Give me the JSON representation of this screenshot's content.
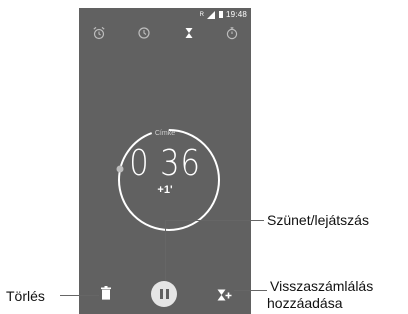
{
  "status_bar": {
    "time": "19:48",
    "signal_marker": "R"
  },
  "tabs": [
    {
      "name": "alarm-icon",
      "active": false
    },
    {
      "name": "clock-icon",
      "active": false
    },
    {
      "name": "hourglass-icon",
      "active": true
    },
    {
      "name": "stopwatch-icon",
      "active": false
    }
  ],
  "timer": {
    "label": "Címke",
    "time": "0 36",
    "plus_one": "+1'"
  },
  "controls": {
    "delete_icon": "trash-icon",
    "pause_icon": "pause-icon",
    "add_timer_icon": "hourglass-plus-icon"
  },
  "annotations": {
    "pause_play": "Szünet/lejátszás",
    "delete": "Törlés",
    "add_timer_line1": "Visszaszámlálás",
    "add_timer_line2": "hozzáadása"
  },
  "colors": {
    "phone_bg": "#616161",
    "accent": "#ffffff",
    "inactive_icon": "#bdbdbd"
  }
}
